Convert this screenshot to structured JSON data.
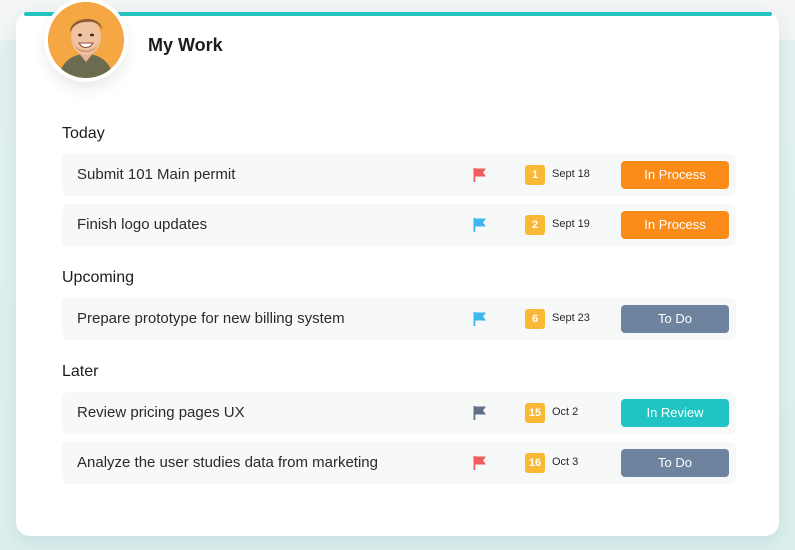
{
  "header": {
    "title": "My Work",
    "accent_color": "#22c4bd"
  },
  "sections": [
    {
      "heading": "Today",
      "tasks": [
        {
          "title": "Submit 101 Main permit",
          "flag_color": "#f25c5c",
          "count": "1",
          "date": "Sept 18",
          "status": "In Process",
          "status_color": "#fb8c1a"
        },
        {
          "title": "Finish logo updates",
          "flag_color": "#3fb7ee",
          "count": "2",
          "date": "Sept 19",
          "status": "In Process",
          "status_color": "#fb8c1a"
        }
      ]
    },
    {
      "heading": "Upcoming",
      "tasks": [
        {
          "title": "Prepare prototype for new billing system",
          "flag_color": "#3fb7ee",
          "count": "6",
          "date": "Sept 23",
          "status": "To Do",
          "status_color": "#6e839d"
        }
      ]
    },
    {
      "heading": "Later",
      "tasks": [
        {
          "title": "Review pricing pages UX",
          "flag_color": "#5f7186",
          "count": "15",
          "date": "Oct 2",
          "status": "In Review",
          "status_color": "#21c4c4"
        },
        {
          "title": "Analyze the user studies data from marketing",
          "flag_color": "#f25c5c",
          "count": "16",
          "date": "Oct 3",
          "status": "To Do",
          "status_color": "#6e839d"
        }
      ]
    }
  ]
}
